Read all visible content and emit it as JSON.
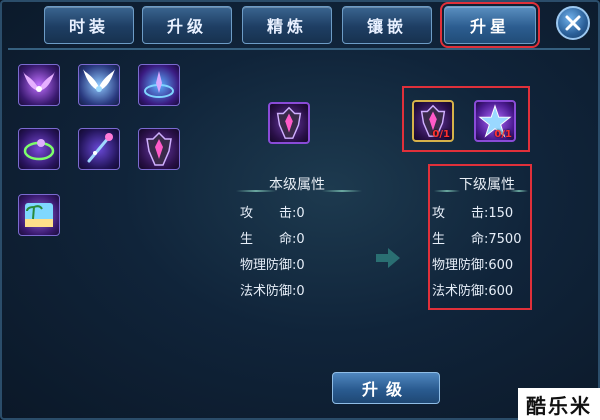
{
  "tabs": [
    {
      "label": "时装"
    },
    {
      "label": "升级"
    },
    {
      "label": "精炼"
    },
    {
      "label": "镶嵌"
    },
    {
      "label": "升星",
      "active": true
    }
  ],
  "left_items": [
    {
      "icon": "purple-wings-icon"
    },
    {
      "icon": "white-wings-icon"
    },
    {
      "icon": "magic-circle-icon"
    },
    {
      "icon": "green-ring-icon"
    },
    {
      "icon": "staff-icon"
    },
    {
      "icon": "armor-icon"
    },
    {
      "icon": "beach-scene-icon"
    }
  ],
  "selected_item_icon": "armor-icon",
  "materials": [
    {
      "icon": "armor-icon",
      "count": "0/1"
    },
    {
      "icon": "star-gem-icon",
      "count": "0/1"
    }
  ],
  "current": {
    "title": "本级属性",
    "stats": [
      {
        "label": "攻　　击:",
        "value": "0"
      },
      {
        "label": "生　　命:",
        "value": "0"
      },
      {
        "label": "物理防御:",
        "value": "0"
      },
      {
        "label": "法术防御:",
        "value": "0"
      }
    ]
  },
  "next": {
    "title": "下级属性",
    "stats": [
      {
        "label": "攻　　击:",
        "value": "150"
      },
      {
        "label": "生　　命:",
        "value": "7500"
      },
      {
        "label": "物理防御:",
        "value": "600"
      },
      {
        "label": "法术防御:",
        "value": "600"
      }
    ]
  },
  "upgrade_button": "升级",
  "watermark": "酷乐米",
  "colors": {
    "highlight": "#e0303a",
    "panel": "#10243a"
  }
}
